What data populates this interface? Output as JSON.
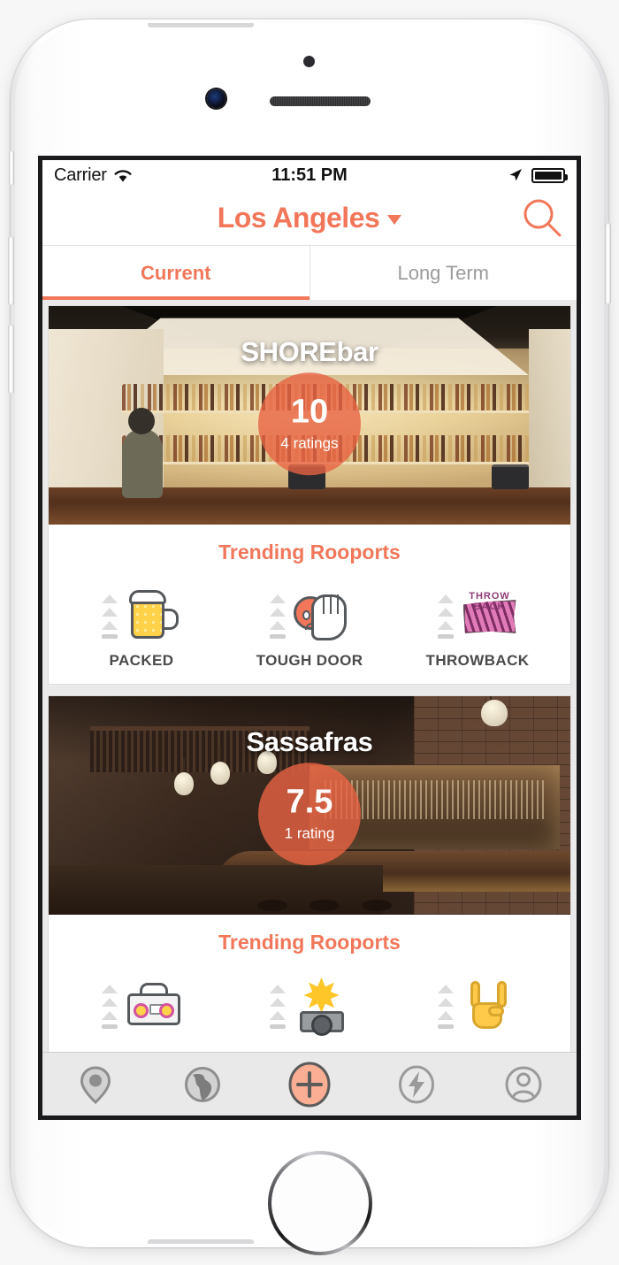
{
  "theme": {
    "accent": "#F2775A",
    "rating_circle": "rgba(233,99,68,0.80)",
    "tabbar_bg": "#e9e9e9",
    "muted_text": "#9b9b9b"
  },
  "status_bar": {
    "carrier": "Carrier",
    "wifi_icon": "wifi-icon",
    "time": "11:51 PM",
    "location_icon": "location-arrow-icon",
    "battery_icon": "battery-full-icon"
  },
  "nav_bar": {
    "city": "Los Angeles",
    "caret_icon": "chevron-down-icon",
    "search_icon": "search-icon"
  },
  "tabs": [
    {
      "label": "Current",
      "active": true
    },
    {
      "label": "Long Term",
      "active": false
    }
  ],
  "feed": {
    "cards": [
      {
        "venue_name": "SHOREbar",
        "photo_name": "shorebar-interior-photo",
        "rating": {
          "score": "10",
          "count_label": "4 ratings"
        },
        "trending_title": "Trending Rooports",
        "reports": [
          {
            "label": "PACKED",
            "icon": "beer-mug-icon"
          },
          {
            "label": "TOUGH DOOR",
            "icon": "tough-door-face-hand-icon"
          },
          {
            "label": "THROWBACK",
            "icon": "throwback-badge-icon"
          }
        ]
      },
      {
        "venue_name": "Sassafras",
        "photo_name": "sassafras-interior-photo",
        "rating": {
          "score": "7.5",
          "count_label": "1 rating"
        },
        "trending_title": "Trending Rooports",
        "reports": [
          {
            "label": "",
            "icon": "boombox-icon"
          },
          {
            "label": "",
            "icon": "camera-flash-icon"
          },
          {
            "label": "",
            "icon": "rock-hand-icon"
          }
        ]
      }
    ]
  },
  "tabbar": [
    {
      "name": "nearby",
      "icon": "map-pin-icon",
      "active": false
    },
    {
      "name": "explore",
      "icon": "globe-icon",
      "active": false
    },
    {
      "name": "add",
      "icon": "plus-circle-icon",
      "active": true
    },
    {
      "name": "activity",
      "icon": "lightning-bolt-icon",
      "active": false
    },
    {
      "name": "profile",
      "icon": "person-circle-icon",
      "active": false
    }
  ]
}
